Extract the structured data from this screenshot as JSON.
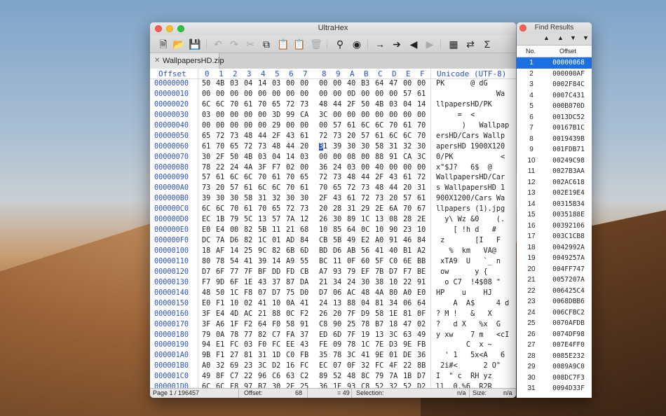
{
  "window": {
    "title": "UltraHex"
  },
  "tab": {
    "filename": "WallpapersHD.zip"
  },
  "header": {
    "offset": "Offset",
    "cols": [
      "0",
      "1",
      "2",
      "3",
      "4",
      "5",
      "6",
      "7",
      "8",
      "9",
      "A",
      "B",
      "C",
      "D",
      "E",
      "F"
    ],
    "unicode": "Unicode (UTF-8)"
  },
  "rows": [
    {
      "o": "00000000",
      "b": [
        "50",
        "4B",
        "03",
        "04",
        "14",
        "03",
        "00",
        "00",
        "00",
        "00",
        "40",
        "B3",
        "64",
        "47",
        "00",
        "00"
      ],
      "t": "PK      @ dG"
    },
    {
      "o": "00000010",
      "b": [
        "00",
        "00",
        "00",
        "00",
        "00",
        "00",
        "00",
        "00",
        "00",
        "00",
        "0D",
        "00",
        "00",
        "00",
        "57",
        "61"
      ],
      "t": "              Wa"
    },
    {
      "o": "00000020",
      "b": [
        "6C",
        "6C",
        "70",
        "61",
        "70",
        "65",
        "72",
        "73",
        "48",
        "44",
        "2F",
        "50",
        "4B",
        "03",
        "04",
        "14"
      ],
      "t": "llpapersHD/PK"
    },
    {
      "o": "00000030",
      "b": [
        "03",
        "00",
        "00",
        "00",
        "00",
        "3D",
        "99",
        "CA",
        "3C",
        "00",
        "00",
        "00",
        "00",
        "00",
        "00",
        "00"
      ],
      "t": "     =  <"
    },
    {
      "o": "00000040",
      "b": [
        "00",
        "00",
        "00",
        "00",
        "00",
        "29",
        "00",
        "00",
        "00",
        "57",
        "61",
        "6C",
        "6C",
        "70",
        "61",
        "70"
      ],
      "t": "      )   Wallpap"
    },
    {
      "o": "00000050",
      "b": [
        "65",
        "72",
        "73",
        "48",
        "44",
        "2F",
        "43",
        "61",
        "72",
        "73",
        "20",
        "57",
        "61",
        "6C",
        "6C",
        "70"
      ],
      "t": "ersHD/Cars Wallp"
    },
    {
      "o": "00000060",
      "b": [
        "61",
        "70",
        "65",
        "72",
        "73",
        "48",
        "44",
        "20",
        "31",
        "39",
        "30",
        "30",
        "58",
        "31",
        "32",
        "30"
      ],
      "t": "apersHD 1900X120"
    },
    {
      "o": "00000070",
      "b": [
        "30",
        "2F",
        "50",
        "4B",
        "03",
        "04",
        "14",
        "03",
        "00",
        "00",
        "08",
        "00",
        "88",
        "91",
        "CA",
        "3C"
      ],
      "t": "0/PK           <"
    },
    {
      "o": "00000080",
      "b": [
        "78",
        "22",
        "24",
        "4A",
        "3F",
        "F7",
        "02",
        "00",
        "36",
        "24",
        "03",
        "00",
        "40",
        "00",
        "00",
        "00"
      ],
      "t": "x\"$J?   6$  @"
    },
    {
      "o": "00000090",
      "b": [
        "57",
        "61",
        "6C",
        "6C",
        "70",
        "61",
        "70",
        "65",
        "72",
        "73",
        "48",
        "44",
        "2F",
        "43",
        "61",
        "72"
      ],
      "t": "WallpapersHD/Car"
    },
    {
      "o": "000000A0",
      "b": [
        "73",
        "20",
        "57",
        "61",
        "6C",
        "6C",
        "70",
        "61",
        "70",
        "65",
        "72",
        "73",
        "48",
        "44",
        "20",
        "31"
      ],
      "t": "s WallpapersHD 1"
    },
    {
      "o": "000000B0",
      "b": [
        "39",
        "30",
        "30",
        "58",
        "31",
        "32",
        "30",
        "30",
        "2F",
        "43",
        "61",
        "72",
        "73",
        "20",
        "57",
        "61"
      ],
      "t": "900X1200/Cars Wa"
    },
    {
      "o": "000000C0",
      "b": [
        "6C",
        "6C",
        "70",
        "61",
        "70",
        "65",
        "72",
        "73",
        "20",
        "28",
        "31",
        "29",
        "2E",
        "6A",
        "70",
        "67"
      ],
      "t": "llpapers (1).jpg"
    },
    {
      "o": "000000D0",
      "b": [
        "EC",
        "1B",
        "79",
        "5C",
        "13",
        "57",
        "7A",
        "12",
        "26",
        "30",
        "89",
        "1C",
        "13",
        "08",
        "28",
        "2E"
      ],
      "t": "  y\\ Wz &0    (."
    },
    {
      "o": "000000E0",
      "b": [
        "E0",
        "E4",
        "00",
        "82",
        "5B",
        "11",
        "21",
        "68",
        "10",
        "85",
        "64",
        "0C",
        "10",
        "90",
        "23",
        "10"
      ],
      "t": "    [ !h d   #"
    },
    {
      "o": "000000F0",
      "b": [
        "DC",
        "7A",
        "D6",
        "82",
        "1C",
        "01",
        "AD",
        "84",
        "CB",
        "5B",
        "49",
        "E2",
        "A0",
        "91",
        "46",
        "84"
      ],
      "t": " z       [I   F"
    },
    {
      "o": "00000100",
      "b": [
        "18",
        "AF",
        "14",
        "25",
        "9C",
        "82",
        "6B",
        "6D",
        "BD",
        "D6",
        "AB",
        "56",
        "41",
        "40",
        "B1",
        "A2"
      ],
      "t": "   %  km   VA@"
    },
    {
      "o": "00000110",
      "b": [
        "80",
        "78",
        "54",
        "41",
        "39",
        "14",
        "A9",
        "55",
        "BC",
        "11",
        "0F",
        "60",
        "5F",
        "C0",
        "6E",
        "BB"
      ],
      "t": " xTA9  U   `_ n"
    },
    {
      "o": "00000120",
      "b": [
        "D7",
        "6F",
        "77",
        "7F",
        "BF",
        "DD",
        "FD",
        "CB",
        "A7",
        "93",
        "79",
        "EF",
        "7B",
        "D7",
        "F7",
        "BE"
      ],
      "t": " ow      y {"
    },
    {
      "o": "00000130",
      "b": [
        "F7",
        "9D",
        "6F",
        "1E",
        "43",
        "37",
        "87",
        "DA",
        "21",
        "34",
        "24",
        "30",
        "38",
        "10",
        "22",
        "91"
      ],
      "t": "  o C7  !4$08 \""
    },
    {
      "o": "00000140",
      "b": [
        "48",
        "50",
        "1C",
        "F8",
        "07",
        "D7",
        "75",
        "D0",
        "D7",
        "06",
        "AC",
        "48",
        "4A",
        "80",
        "A0",
        "E0"
      ],
      "t": "HP    u    HJ"
    },
    {
      "o": "00000150",
      "b": [
        "E0",
        "F1",
        "10",
        "02",
        "41",
        "10",
        "0A",
        "41",
        "24",
        "13",
        "88",
        "04",
        "81",
        "34",
        "06",
        "64"
      ],
      "t": "    A  A$     4 d"
    },
    {
      "o": "00000160",
      "b": [
        "3F",
        "E4",
        "4D",
        "AC",
        "21",
        "88",
        "0C",
        "F2",
        "26",
        "20",
        "7F",
        "D9",
        "58",
        "1E",
        "81",
        "0F"
      ],
      "t": "? M !   &   X"
    },
    {
      "o": "00000170",
      "b": [
        "3F",
        "A6",
        "1F",
        "F2",
        "64",
        "F0",
        "58",
        "91",
        "C8",
        "90",
        "25",
        "78",
        "B7",
        "18",
        "47",
        "02"
      ],
      "t": "?   d X   %x  G"
    },
    {
      "o": "00000180",
      "b": [
        "79",
        "0A",
        "78",
        "77",
        "82",
        "C7",
        "FA",
        "37",
        "ED",
        "6D",
        "7F",
        "19",
        "13",
        "3C",
        "63",
        "49"
      ],
      "t": "y xw    7 m   <cI"
    },
    {
      "o": "00000190",
      "b": [
        "94",
        "E1",
        "FC",
        "03",
        "F0",
        "FC",
        "EE",
        "43",
        "FE",
        "09",
        "78",
        "1C",
        "7E",
        "D3",
        "9E",
        "FB"
      ],
      "t": "       C  x ~"
    },
    {
      "o": "000001A0",
      "b": [
        "9B",
        "F1",
        "27",
        "81",
        "31",
        "1D",
        "C0",
        "FB",
        "35",
        "78",
        "3C",
        "41",
        "9E",
        "01",
        "DE",
        "36"
      ],
      "t": "  ' 1   5x<A   6"
    },
    {
      "o": "000001B0",
      "b": [
        "A0",
        "32",
        "69",
        "23",
        "3C",
        "D2",
        "16",
        "FC",
        "EC",
        "07",
        "0F",
        "32",
        "FC",
        "4F",
        "22",
        "8B"
      ],
      "t": " 2i#<      2 O\""
    },
    {
      "o": "000001C0",
      "b": [
        "49",
        "8F",
        "C7",
        "22",
        "96",
        "C6",
        "63",
        "C2",
        "89",
        "52",
        "48",
        "8C",
        "79",
        "7A",
        "1B",
        "D7"
      ],
      "t": "I  \" c  RH yz"
    },
    {
      "o": "000001D0",
      "b": [
        "6C",
        "6C",
        "F8",
        "97",
        "B7",
        "30",
        "2E",
        "25",
        "36",
        "1E",
        "93",
        "C8",
        "52",
        "32",
        "52",
        "D2"
      ],
      "t": "ll  0.%6  R2R"
    }
  ],
  "status": {
    "page": "Page 1 / 196457",
    "offset_label": "Offset:",
    "offset_value": "68",
    "eq_value": "= 49",
    "selection_label": "Selection:",
    "selection_value": "n/a",
    "size_label": "Size:",
    "size_value": "n/a"
  },
  "find": {
    "title": "Find Results",
    "col_no": "No.",
    "col_offset": "Offset",
    "results": [
      {
        "n": "1",
        "o": "00000068"
      },
      {
        "n": "2",
        "o": "000000AF"
      },
      {
        "n": "3",
        "o": "0002F84C"
      },
      {
        "n": "4",
        "o": "0007C431"
      },
      {
        "n": "5",
        "o": "000B070D"
      },
      {
        "n": "6",
        "o": "0013DC52"
      },
      {
        "n": "7",
        "o": "00167B1C"
      },
      {
        "n": "8",
        "o": "0019439B"
      },
      {
        "n": "9",
        "o": "001FDB71"
      },
      {
        "n": "10",
        "o": "00249C98"
      },
      {
        "n": "11",
        "o": "0027B3AA"
      },
      {
        "n": "12",
        "o": "002AC618"
      },
      {
        "n": "13",
        "o": "002E19E4"
      },
      {
        "n": "14",
        "o": "00315B34"
      },
      {
        "n": "15",
        "o": "0035188E"
      },
      {
        "n": "16",
        "o": "00392106"
      },
      {
        "n": "17",
        "o": "003C1CB8"
      },
      {
        "n": "18",
        "o": "0042992A"
      },
      {
        "n": "19",
        "o": "0049257A"
      },
      {
        "n": "20",
        "o": "004FF747"
      },
      {
        "n": "21",
        "o": "0057207A"
      },
      {
        "n": "22",
        "o": "006425C4"
      },
      {
        "n": "23",
        "o": "0068DBB6"
      },
      {
        "n": "24",
        "o": "006CFBC2"
      },
      {
        "n": "25",
        "o": "0070AFDB"
      },
      {
        "n": "26",
        "o": "0074DF98"
      },
      {
        "n": "27",
        "o": "007E4FF0"
      },
      {
        "n": "28",
        "o": "0085E232"
      },
      {
        "n": "29",
        "o": "0089A9C0"
      },
      {
        "n": "30",
        "o": "008DC7F3"
      },
      {
        "n": "31",
        "o": "0094D33F"
      }
    ]
  }
}
